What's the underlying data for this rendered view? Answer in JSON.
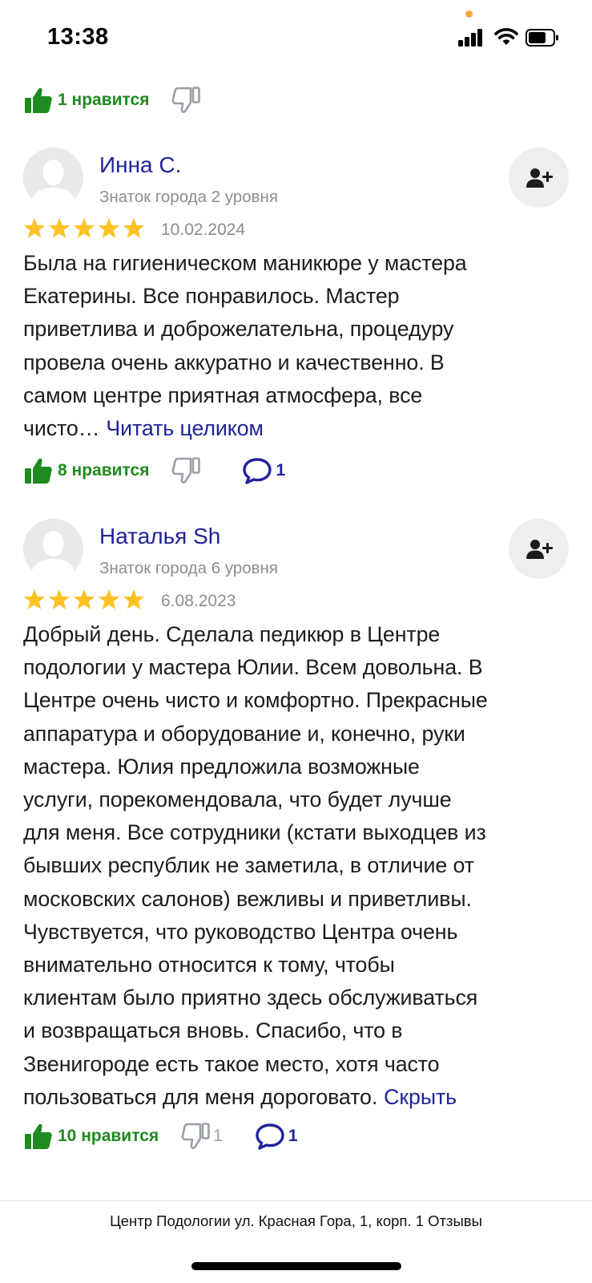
{
  "colors": {
    "like_green": "#1f8a1f",
    "link_blue": "#20239b",
    "star_yellow": "#fdc326",
    "muted_gray": "#8a8d91",
    "status_dot_orange": "#f6a53c"
  },
  "status_bar": {
    "time": "13:38",
    "icons": [
      "cellular-signal-icon",
      "wifi-icon",
      "battery-icon"
    ]
  },
  "top_reactions": {
    "like_label": "1 нравится"
  },
  "reviews": [
    {
      "author": "Инна С.",
      "rank": "Знаток города 2 уровня",
      "rating": 5,
      "date": "10.02.2024",
      "text_lines": [
        "Была на гигиеническом маникюре у мастера",
        "Екатерины. Все понравилось. Мастер",
        "приветлива и доброжелательна, процедуру",
        "провела очень аккуратно и качественно. В",
        "самом центре приятная атмосфера, все",
        "чисто…"
      ],
      "link": "Читать целиком",
      "like_label": "8 нравится",
      "dislike_count": "",
      "comment_count": "1"
    },
    {
      "author": "Наталья Sh",
      "rank": "Знаток города 6 уровня",
      "rating": 5,
      "date": "6.08.2023",
      "text_lines": [
        "Добрый день. Сделала педикюр в Центре",
        "подологии у мастера Юлии. Всем довольна. В",
        "Центре очень чисто и комфортно. Прекрасные",
        "аппаратура и оборудование и, конечно, руки",
        "мастера. Юлия предложила возможные",
        "услуги, порекомендовала, что будет лучше",
        "для меня. Все сотрудники (кстати выходцев из",
        "бывших республик не заметила, в отличие от",
        "московских салонов) вежливы и приветливы.",
        "Чувствуется, что руководство Центра очень",
        "внимательно относится к тому, чтобы",
        "клиентам было приятно здесь обслуживаться",
        "и возвращаться вновь. Спасибо, что в",
        "Звенигороде есть такое место, хотя часто",
        "пользоваться для меня дороговато."
      ],
      "link": "Скрыть",
      "like_label": "10 нравится",
      "dislike_count": "1",
      "comment_count": "1"
    }
  ],
  "footer": {
    "title": "Центр Подологии ул. Красная Гора, 1, корп. 1 Отзывы"
  }
}
